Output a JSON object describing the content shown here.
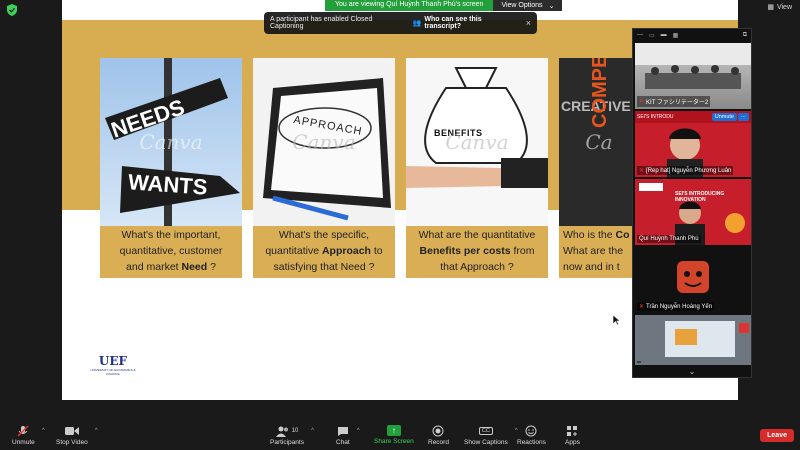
{
  "top": {
    "viewing_text": "You are viewing Quí Huỳnh Thanh Phú's screen",
    "view_options": "View Options",
    "view": "View"
  },
  "notice": {
    "message": "A participant has enabled Closed Captioning",
    "question": "Who can see this transcript?"
  },
  "slide": {
    "cards": [
      {
        "img_text_1": "NEEDS",
        "img_text_2": "WANTS",
        "watermark": "Canva",
        "cap": [
          "What's the important,",
          "quantitative, customer",
          "and market ",
          "Need",
          " ?"
        ]
      },
      {
        "img_text_1": "APPROACH",
        "watermark": "Canva",
        "cap": [
          "What's the specific,",
          "quantitative ",
          "Approach",
          " to",
          "satisfying that Need ?"
        ]
      },
      {
        "img_text_1": "BENEFITS",
        "watermark": "Canva",
        "cap": [
          "What are the quantitative",
          "Benefits per costs",
          " from",
          "that Approach ?"
        ]
      },
      {
        "img_text_1": "CREATIVE",
        "img_text_2": "COMPETITIVE",
        "watermark": "Ca",
        "cap": [
          "Who is the ",
          "Co",
          "What are the",
          "now and in t"
        ]
      }
    ],
    "logo": "UEF",
    "logo_sub": "UNIVERSITY OF ECONOMICS & FINANCE"
  },
  "panel": {
    "tiles": [
      {
        "name": "KIT ファシリテーター2"
      },
      {
        "name": "[Rep hat] Nguyễn Phương Luân",
        "unmute": "Unmute",
        "more": "···",
        "banner": "SEI'S INTRODU"
      },
      {
        "name": "Quí Huỳnh Thanh Phú",
        "banner": "SEI'S INTRODUCING INNOVATION"
      },
      {
        "name": "Trần Nguyễn Hoàng Yến"
      },
      {
        "name": ""
      }
    ]
  },
  "toolbar": {
    "unmute": "Unmute",
    "stop_video": "Stop Video",
    "participants": "Participants",
    "participant_count": "10",
    "chat": "Chat",
    "share_screen": "Share Screen",
    "record": "Record",
    "show_captions": "Show Captions",
    "cc": "CC",
    "reactions": "Reactions",
    "apps": "Apps",
    "leave": "Leave"
  },
  "colors": {
    "band": "#d8ad52",
    "share": "#23a03b",
    "leave": "#d42b2b"
  }
}
